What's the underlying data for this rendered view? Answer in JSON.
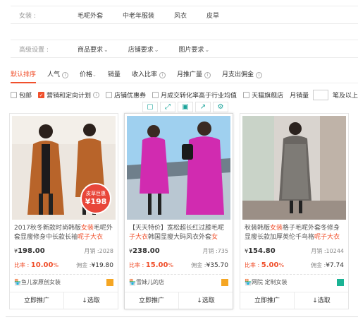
{
  "category_bar": {
    "label": "女装 :",
    "items": [
      "毛呢外套",
      "中老年服装",
      "风衣",
      "皮草"
    ]
  },
  "advanced_bar": {
    "label": "高级设置 :",
    "dropdowns": [
      "商品要求",
      "店铺要求",
      "图片要求"
    ]
  },
  "sort_tabs": [
    {
      "label": "默认排序",
      "active": true
    },
    {
      "label": "人气",
      "info": true
    },
    {
      "label": "价格",
      "chevron": true
    },
    {
      "label": "销量"
    },
    {
      "label": "收入比率",
      "info": true
    },
    {
      "label": "月推广量",
      "info": true
    },
    {
      "label": "月支出佣金",
      "info": true
    }
  ],
  "filters": {
    "items": [
      {
        "label": "包邮",
        "checked": false
      },
      {
        "label": "营销和定向计划",
        "checked": true,
        "info": true
      },
      {
        "label": "店铺优惠券",
        "checked": false
      },
      {
        "label": "月成交转化率高于行业均值",
        "checked": false
      },
      {
        "label": "天猫旗舰店",
        "checked": false
      }
    ],
    "monthly_sales_label": "月销量",
    "trailing_text": "笔及以上"
  },
  "toolbar_icons": [
    "qrcode-icon",
    "expand-icon",
    "save-icon",
    "share-icon",
    "settings-icon"
  ],
  "products": [
    {
      "title_pre": "2017秋冬新款时尚韩版",
      "title_hl1": "女装",
      "title_mid": "毛呢外套显瘦修身中长款长袖",
      "title_hl2": "呢子大衣",
      "price_symbol": "¥",
      "price": "198.00",
      "sales_label": "月销 :",
      "sales": "2028",
      "rate_label": "比率 :",
      "rate": "10.00",
      "rate_unit": "%",
      "commission_label": "佣金 :",
      "commission": "¥19.80",
      "shop": "鱼儿家原创女装",
      "shop_badge_color": "#f5a623",
      "promo_top": "皮草巨惠",
      "promo_price": "¥198",
      "actions": [
        "立即推广",
        "↓选取"
      ]
    },
    {
      "title_pre": "【天天特价】宽松超长红过膝毛呢",
      "title_hl1": "子大衣",
      "title_mid": "韩国显瘦大码风衣外套",
      "title_hl2": "女",
      "title_hl2_color": "#f0502c",
      "price_symbol": "¥",
      "price": "238.00",
      "sales_label": "月销 :",
      "sales": "735",
      "rate_label": "比率 :",
      "rate": "15.00",
      "rate_unit": "%",
      "commission_label": "佣金 :",
      "commission": "¥35.70",
      "shop": "雪妹儿的店",
      "shop_badge_color": "#f5a623",
      "actions": [
        "立即推广",
        "↓选取"
      ]
    },
    {
      "title_pre": "秋装韩版",
      "title_hl1": "女装",
      "title_mid": "格子毛呢外套冬修身显瘦长款加厚英伦千鸟格",
      "title_hl2": "呢子大衣",
      "price_symbol": "¥",
      "price": "154.80",
      "sales_label": "月销 :",
      "sales": "10244",
      "rate_label": "比率 :",
      "rate": "5.00",
      "rate_unit": "%",
      "commission_label": "佣金 :",
      "commission": "¥7.74",
      "shop": "网院 定制女装",
      "shop_badge_color": "#1ab394",
      "actions": [
        "立即推广",
        "↓选取"
      ]
    }
  ],
  "colors": {
    "accent": "#f0502c",
    "teal": "#1aa39a"
  }
}
